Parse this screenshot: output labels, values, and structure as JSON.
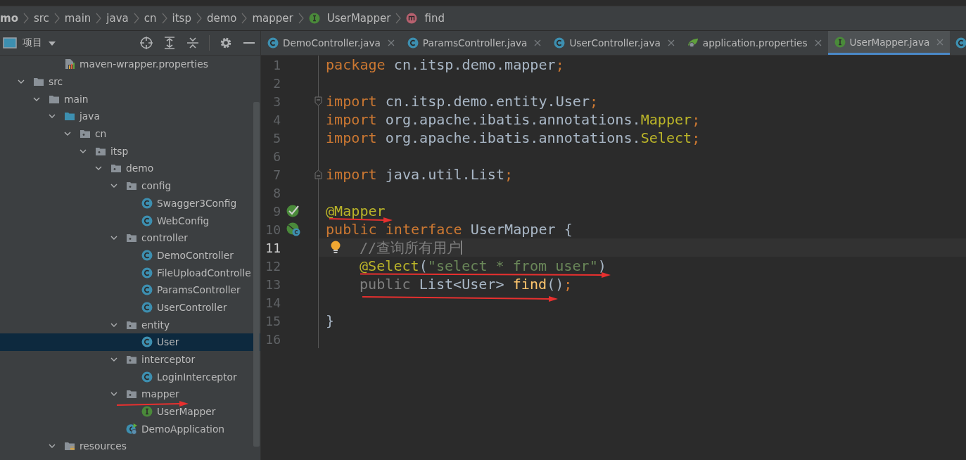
{
  "breadcrumb": [
    {
      "label": "mo",
      "kind": "module"
    },
    {
      "label": "src",
      "kind": "folder"
    },
    {
      "label": "main",
      "kind": "folder"
    },
    {
      "label": "java",
      "kind": "folder"
    },
    {
      "label": "cn",
      "kind": "folder"
    },
    {
      "label": "itsp",
      "kind": "folder"
    },
    {
      "label": "demo",
      "kind": "folder"
    },
    {
      "label": "mapper",
      "kind": "folder"
    },
    {
      "label": "UserMapper",
      "kind": "interface"
    },
    {
      "label": "find",
      "kind": "method"
    }
  ],
  "project_panel": {
    "title": "项目",
    "tree": [
      {
        "children": [
          {
            "children": [
              {
                "label": "maven-wrapper.properties",
                "kind": "properties",
                "selected": false
              }
            ]
          }
        ]
      },
      {
        "label": "src",
        "kind": "folder",
        "expanded": true,
        "selected": false,
        "children": [
          {
            "label": "main",
            "kind": "folder",
            "expanded": true,
            "selected": false,
            "children": [
              {
                "label": "java",
                "kind": "source",
                "expanded": true,
                "selected": false,
                "children": [
                  {
                    "label": "cn",
                    "kind": "package",
                    "expanded": true,
                    "selected": false,
                    "children": [
                      {
                        "label": "itsp",
                        "kind": "package",
                        "expanded": true,
                        "selected": false,
                        "children": [
                          {
                            "label": "demo",
                            "kind": "package",
                            "expanded": true,
                            "selected": false,
                            "children": [
                              {
                                "label": "config",
                                "kind": "package",
                                "expanded": true,
                                "selected": false,
                                "children": [
                                  {
                                    "label": "Swagger3Config",
                                    "kind": "class",
                                    "selected": false
                                  },
                                  {
                                    "label": "WebConfig",
                                    "kind": "class",
                                    "selected": false
                                  }
                                ]
                              },
                              {
                                "label": "controller",
                                "kind": "package",
                                "expanded": true,
                                "selected": false,
                                "children": [
                                  {
                                    "label": "DemoController",
                                    "kind": "class",
                                    "selected": false
                                  },
                                  {
                                    "label": "FileUploadControlle",
                                    "kind": "class",
                                    "selected": false
                                  },
                                  {
                                    "label": "ParamsController",
                                    "kind": "class",
                                    "selected": false
                                  },
                                  {
                                    "label": "UserController",
                                    "kind": "class",
                                    "selected": false
                                  }
                                ]
                              },
                              {
                                "label": "entity",
                                "kind": "package",
                                "expanded": true,
                                "selected": false,
                                "children": [
                                  {
                                    "label": "User",
                                    "kind": "class",
                                    "selected": true
                                  }
                                ]
                              },
                              {
                                "label": "interceptor",
                                "kind": "package",
                                "expanded": true,
                                "selected": false,
                                "children": [
                                  {
                                    "label": "LoginInterceptor",
                                    "kind": "class",
                                    "selected": false
                                  }
                                ]
                              },
                              {
                                "label": "mapper",
                                "kind": "package",
                                "expanded": true,
                                "selected": false,
                                "children": [
                                  {
                                    "label": "UserMapper",
                                    "kind": "interface",
                                    "selected": false
                                  }
                                ]
                              },
                              {
                                "label": "DemoApplication",
                                "kind": "spring-app",
                                "selected": false
                              }
                            ]
                          }
                        ]
                      }
                    ]
                  }
                ]
              },
              {
                "label": "resources",
                "kind": "resources",
                "expanded": true,
                "selected": false
              }
            ]
          }
        ]
      }
    ]
  },
  "tabs": [
    {
      "label": "DemoController.java",
      "kind": "class",
      "selected": false
    },
    {
      "label": "ParamsController.java",
      "kind": "class",
      "selected": false
    },
    {
      "label": "UserController.java",
      "kind": "class",
      "selected": false
    },
    {
      "label": "application.properties",
      "kind": "spring-props",
      "selected": false
    },
    {
      "label": "UserMapper.java",
      "kind": "interface",
      "selected": true
    }
  ],
  "code": [
    {
      "number": "1",
      "tokens": [
        {
          "text": "package",
          "kind": "keyword"
        },
        {
          "text": " cn.itsp.demo.mapper",
          "kind": "plain"
        },
        {
          "text": ";",
          "kind": "punct"
        }
      ]
    },
    {
      "number": "2"
    },
    {
      "number": "3",
      "fold_start": true,
      "tokens": [
        {
          "text": "import",
          "kind": "keyword"
        },
        {
          "text": " cn.itsp.demo.entity.User",
          "kind": "plain"
        },
        {
          "text": ";",
          "kind": "punct"
        }
      ]
    },
    {
      "number": "4",
      "tokens": [
        {
          "text": "import",
          "kind": "keyword"
        },
        {
          "text": " org.apache.ibatis.annotations.",
          "kind": "plain"
        },
        {
          "text": "Mapper",
          "kind": "annotation"
        },
        {
          "text": ";",
          "kind": "punct"
        }
      ]
    },
    {
      "number": "5",
      "tokens": [
        {
          "text": "import",
          "kind": "keyword"
        },
        {
          "text": " org.apache.ibatis.annotations.",
          "kind": "plain"
        },
        {
          "text": "Select",
          "kind": "annotation"
        },
        {
          "text": ";",
          "kind": "punct"
        }
      ]
    },
    {
      "number": "6"
    },
    {
      "number": "7",
      "fold_end": true,
      "tokens": [
        {
          "text": "import",
          "kind": "keyword"
        },
        {
          "text": " java.util.List",
          "kind": "plain"
        },
        {
          "text": ";",
          "kind": "punct"
        }
      ]
    },
    {
      "number": "8"
    },
    {
      "number": "9",
      "bean_marker": true,
      "tokens": [
        {
          "text": "@Mapper",
          "kind": "annotation"
        }
      ]
    },
    {
      "number": "10",
      "implemented_marker": true,
      "tokens": [
        {
          "text": "public interface",
          "kind": "keyword"
        },
        {
          "text": " UserMapper {",
          "kind": "plain"
        }
      ]
    },
    {
      "number": "11",
      "current": true,
      "intention": true,
      "indented": true,
      "tokens": [
        {
          "text": "//查询所有用户",
          "kind": "comment"
        }
      ]
    },
    {
      "number": "12",
      "indented": true,
      "tokens": [
        {
          "text": "@Select",
          "kind": "annotation"
        },
        {
          "text": "(",
          "kind": "plain"
        },
        {
          "text": "\"select * from user\"",
          "kind": "string"
        },
        {
          "text": ")",
          "kind": "plain"
        }
      ]
    },
    {
      "number": "13",
      "indented": true,
      "tokens": [
        {
          "text": "public",
          "kind": "muted"
        },
        {
          "text": " List<User> ",
          "kind": "plain"
        },
        {
          "text": "find",
          "kind": "method"
        },
        {
          "text": "()",
          "kind": "plain"
        },
        {
          "text": ";",
          "kind": "punct"
        }
      ]
    },
    {
      "number": "14"
    },
    {
      "number": "15",
      "tokens": [
        {
          "text": "}",
          "kind": "plain"
        }
      ]
    },
    {
      "number": "16"
    }
  ]
}
